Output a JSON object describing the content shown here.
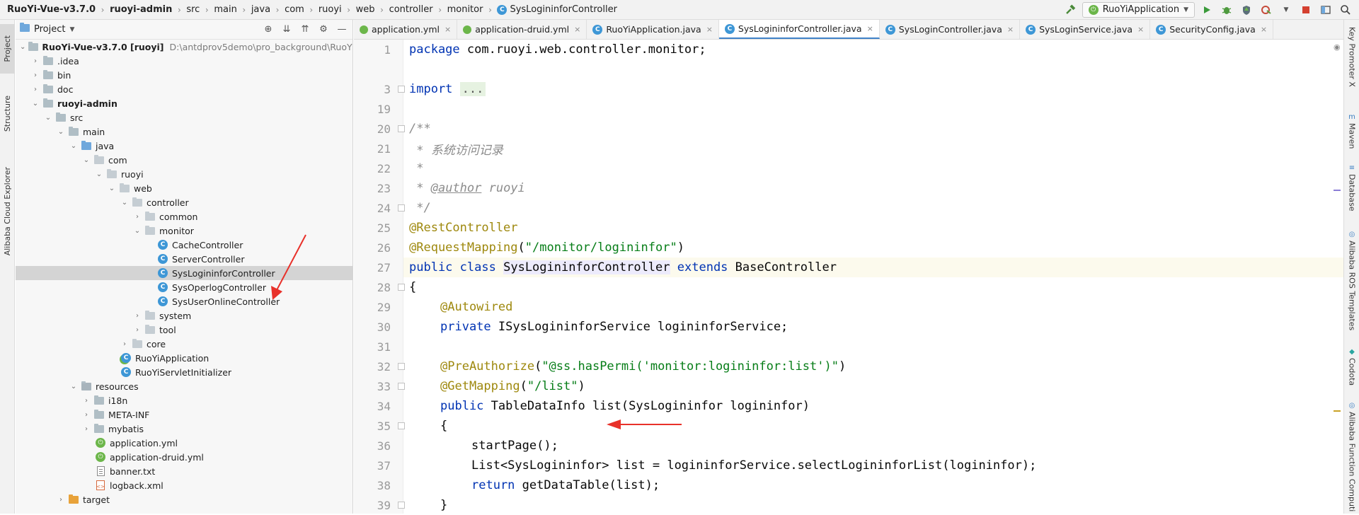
{
  "navbar": {
    "breadcrumbs": [
      "RuoYi-Vue-v3.7.0",
      "ruoyi-admin",
      "src",
      "main",
      "java",
      "com",
      "ruoyi",
      "web",
      "controller",
      "monitor",
      "SysLogininforController"
    ],
    "class_badge": "C",
    "run_config": "RuoYiApplication"
  },
  "left_strip": {
    "tabs": [
      "Project",
      "Structure",
      "Alibaba Cloud Explorer"
    ]
  },
  "right_strip": {
    "tabs": [
      "Key Promoter X",
      "Maven",
      "Database",
      "Alibaba ROS Templates",
      "Codota",
      "Alibaba Function Computi"
    ]
  },
  "project_panel": {
    "title": "Project",
    "root_name": "RuoYi-Vue-v3.7.0 [ruoyi]",
    "root_path": "D:\\antdprov5demo\\pro_background\\RuoYi-Vue-",
    "items": {
      "idea": ".idea",
      "bin": "bin",
      "doc": "doc",
      "ruoyi_admin": "ruoyi-admin",
      "src": "src",
      "main": "main",
      "java": "java",
      "com": "com",
      "ruoyi": "ruoyi",
      "web": "web",
      "controller": "controller",
      "common": "common",
      "monitor": "monitor",
      "cache_controller": "CacheController",
      "server_controller": "ServerController",
      "syslogininfor_controller": "SysLogininforController",
      "sysoperlog_controller": "SysOperlogController",
      "sysuseronline_controller": "SysUserOnlineController",
      "system": "system",
      "tool": "tool",
      "core": "core",
      "ruoyi_application": "RuoYiApplication",
      "ruoyi_servlet_initializer": "RuoYiServletInitializer",
      "resources": "resources",
      "i18n": "i18n",
      "meta_inf": "META-INF",
      "mybatis": "mybatis",
      "application_yml": "application.yml",
      "application_druid_yml": "application-druid.yml",
      "banner_txt": "banner.txt",
      "logback_xml": "logback.xml",
      "target": "target"
    }
  },
  "editor": {
    "tabs": [
      {
        "label": "application.yml",
        "active": false
      },
      {
        "label": "application-druid.yml",
        "active": false
      },
      {
        "label": "RuoYiApplication.java",
        "active": false
      },
      {
        "label": "SysLogininforController.java",
        "active": true
      },
      {
        "label": "SysLoginController.java",
        "active": false
      },
      {
        "label": "SysLoginService.java",
        "active": false
      },
      {
        "label": "SecurityConfig.java",
        "active": false
      }
    ],
    "line_numbers": [
      "1",
      "3",
      "19",
      "20",
      "21",
      "22",
      "23",
      "24",
      "25",
      "26",
      "27",
      "28",
      "29",
      "30",
      "31",
      "32",
      "33",
      "34",
      "35",
      "36",
      "37",
      "38",
      "39"
    ],
    "code": {
      "l1_kw": "package",
      "l1_rest": " com.ruoyi.web.controller.monitor;",
      "l3_kw": "import",
      "l3_dots": "...",
      "l20": "/**",
      "l21": " * 系统访问记录",
      "l22": " *",
      "l23_pre": " * ",
      "l23_tag": "@author",
      "l23_post": " ruoyi",
      "l24": " */",
      "l25": "@RestController",
      "l26_an": "@RequestMapping",
      "l26_open": "(",
      "l26_str": "\"/monitor/logininfor\"",
      "l26_close": ")",
      "l27_kw1": "public",
      "l27_kw2": "class",
      "l27_name": "SysLogininforController",
      "l27_kw3": "extends",
      "l27_base": "BaseController",
      "l28": "{",
      "l29": "@Autowired",
      "l30_kw": "private",
      "l30_rest": " ISysLogininforService logininforService;",
      "l32_an": "@PreAuthorize",
      "l32_open": "(",
      "l32_str": "\"@ss.hasPermi('monitor:logininfor:list')\"",
      "l32_close": ")",
      "l33_an": "@GetMapping",
      "l33_open": "(",
      "l33_str": "\"/list\"",
      "l33_close": ")",
      "l34_kw": "public",
      "l34_rest": " TableDataInfo list(SysLogininfor logininfor)",
      "l35": "{",
      "l36": "startPage();",
      "l37": "List<SysLogininfor> list = logininforService.selectLogininforList(logininfor);",
      "l38_kw": "return",
      "l38_rest": " getDataTable(list);",
      "l39": "}"
    }
  }
}
